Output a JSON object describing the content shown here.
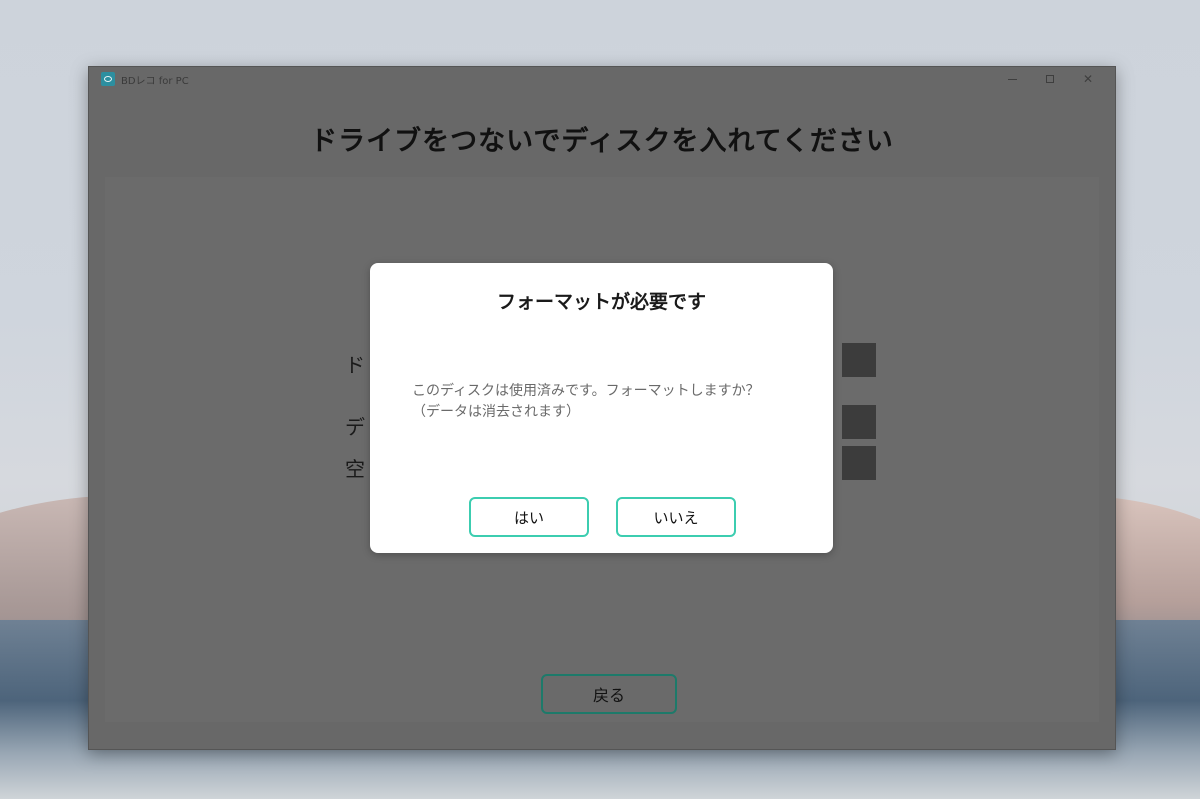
{
  "window": {
    "title": "BDレコ for PC",
    "icon": "disc-app-icon"
  },
  "main": {
    "heading": "ドライブをつないでディスクを入れてください",
    "labels": [
      "ド",
      "デ",
      "空"
    ],
    "back_label": "戻る"
  },
  "dialog": {
    "title": "フォーマットが必要です",
    "message_line1": "このディスクは使用済みです。フォーマットしますか？",
    "message_line2": "（データは消去されます）",
    "yes_label": "はい",
    "no_label": "いいえ"
  },
  "colors": {
    "accent": "#3ccdb0",
    "overlay": "#686868"
  }
}
